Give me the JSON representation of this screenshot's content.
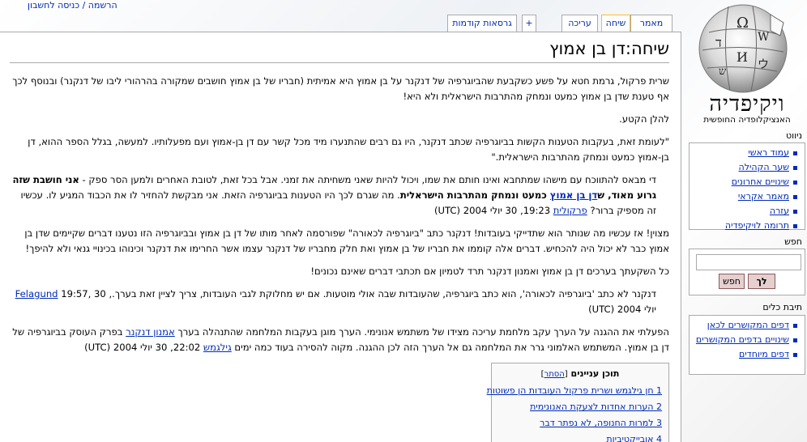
{
  "personal": {
    "login_label": "הרשמה / כניסה לחשבון"
  },
  "tabs": [
    {
      "label": "מאמר",
      "selected": false
    },
    {
      "label": "שיחה",
      "selected": true
    },
    {
      "label": "עריכה",
      "selected": false
    },
    {
      "label": "+",
      "selected": false
    },
    {
      "label": "גרסאות קודמות",
      "selected": false
    }
  ],
  "page": {
    "title": "שיחה:דן בן אמוץ",
    "p1": "שרית פרקול, גרמת חטא על פשע כשקבעת שהביוגרפיה של דנקנר על בן אמוץ היא אמיתית (חבריו של בן אמוץ חושבים שמקורה בהרהורי ליבו של דנקנר) ובנוסף לכך אף טענת שדן בן אמוץ כמעט ונמחק מהתרבות הישראלית ולא היא!",
    "p2": "להלן הקטע.",
    "p3": "\"לעומת זאת, בעקבות הטענות הקשות בביוגרפיה שכתב דנקנר, היו גם רבים שהתנערו מיד מכל קשר עם דן בן-אמוץ ועם מפעלותיו. למעשה, בגלל הספר ההוא, דן בן-אמוץ כמעט ונמחק מהתרבות הישראלית.\"",
    "reply1_a": "די מבאס להתווכח עם מישהו שמתחבא ואינו חותם את שמו, ויכול להיות שאני משחיתה את זמני. אבל בכל זאת, לטובת האחרים ולמען הסר ספק - ",
    "reply1_bold1": "אני חושבת שזה גרוע מאוד, ",
    "reply1_link_ben_amotz": "דן בן אמוץ",
    "reply1_bold2_prefix": "ש",
    "reply1_bold3": " כמעט ונמחק מהתרבות הישראלית",
    "reply1_b": ". מה שגרם לכך היו הטענות בביוגרפיה הזאת. אני מבקשת להחזיר לו את הכבוד המגיע לו. עכשיו זה מספיק ברור? ",
    "reply1_user": "פרקולית",
    "reply1_time": " 19:23, 30 יולי 2004 (UTC)",
    "p4": "מצוין! אז עכשיו מה שנותר הוא שתדייקי בעובדות! דנקנר כתב \"ביוגרפיה לכאורה\" שפורסמה לאחר מותו של דן בן אמוץ ובביוגרפיה הזו נטענו דברים שקיימים שדן בן אמוץ כבר לא יכול היה להכחיש. דברים אלה קוממו את חבריו של בן אמוץ ואת חלק מחבריו של דנקנר עצמו אשר החרימו את דנקנר וכינוהו בכינויי גנאי ולא להיפך!",
    "p5": "כל השקעתך בערכים דן בן אמוץ ואמנון דנקנר תרד לטמיון אם תכתבי דברים שאינם נכונים!",
    "reply2_a": "דנקנר לא כתב 'ביוגרפיה לכאורה', הוא כתב ביוגרפיה, שהעובדות שבה אולי מוטעות. אם יש מחלוקת לגבי העובדות, צריך לציין זאת בערך.,",
    "reply2_user": "Felagund",
    "reply2_time": " 19:57, 30 יולי 2004 (UTC)",
    "p6_a": "הפעלתי את ההגנה על הערך עקב מלחמת עריכה מצידו של משתמש אנונימי. הערך מוגן בעקבות המלחמה שהתנהלה בערך ",
    "p6_link": "אמנון דנקנר",
    "p6_b": " בפרק העוסק בביוגרפיה של דן בן אמוץ. המשתמש האלמוני גרר את המלחמה גם אל הערך הזה לכן ההגנה. מקוה להסירה בעוד כמה ימים ",
    "p6_user": "גילגמש",
    "p6_time": " 22:02, 30 יולי 2004 (UTC)"
  },
  "toc": {
    "title": "תוכן עניינים",
    "toggle": "הסתר",
    "items": [
      "1 חן גילגמש ושרית פרקול העובדות הן פשוטות",
      "2 הערות אחדות לצעקת האנונימית",
      "3 למרות החנופה, לא נפתר דבר",
      "4 אובייקטיביות"
    ]
  },
  "logo": {
    "name": "ויקיפדיה",
    "tagline": "האנציקלופדיה החופשית"
  },
  "navigation": {
    "heading": "ניווט",
    "items": [
      "עמוד ראשי",
      "שער הקהילה",
      "שינויים אחרונים",
      "מאמר אקראי",
      "עזרה",
      "תרומה לויקיפדיה"
    ]
  },
  "search": {
    "heading": "חפש",
    "go_label": "לך",
    "search_label": "חפש"
  },
  "toolbox": {
    "heading": "תיבת כלים",
    "items": [
      "דפים המקושרים לכאן",
      "שינויים בדפים המקושרים",
      "דפים מיוחדים"
    ]
  },
  "colors": {
    "link": "#002bb8",
    "selected_tab": "#fabd23",
    "border": "#aaaaaa"
  }
}
